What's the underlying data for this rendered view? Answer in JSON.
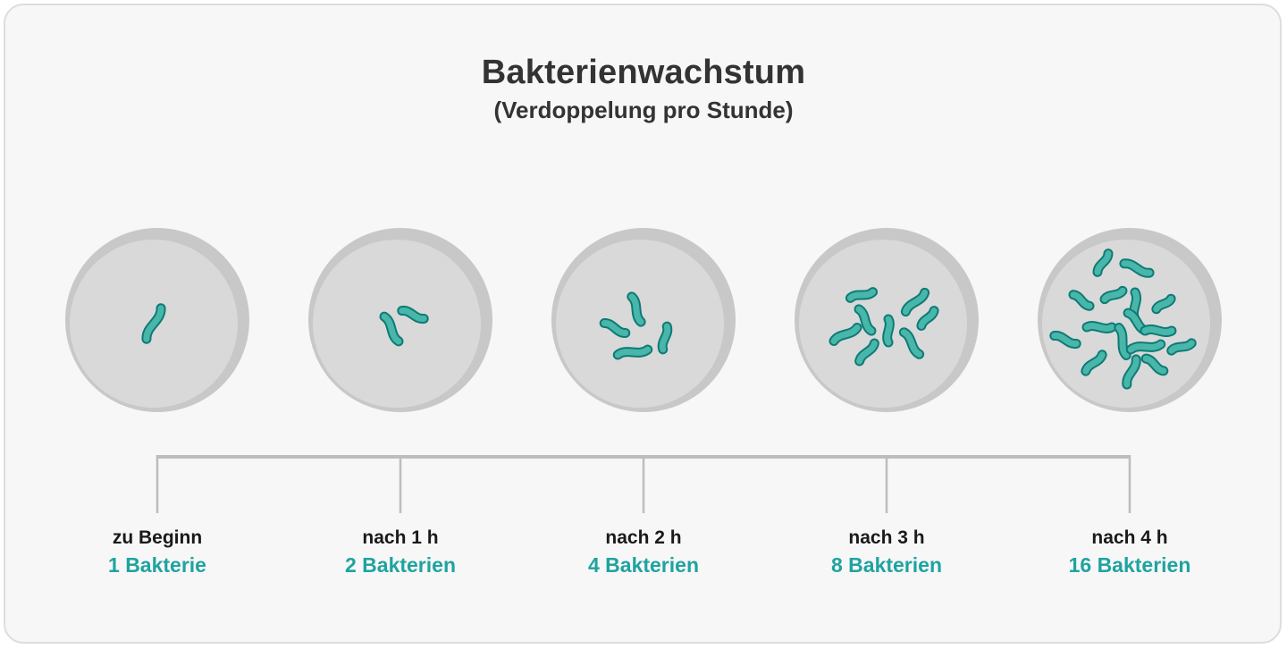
{
  "title": "Bakterienwachstum",
  "subtitle": "(Verdoppelung pro Stunde)",
  "colors": {
    "accent": "#1fa3a0",
    "bacterium_fill": "#48b7aa",
    "bacterium_outline": "#0e7a76",
    "dish_rim": "#c8c8c8",
    "dish_inner": "#d9d9d9",
    "timeline": "#bdbdbd",
    "text": "#1a1a1a"
  },
  "stages": [
    {
      "time_label": "zu Beginn",
      "count_label": "1 Bakterie",
      "bacteria_count": 1
    },
    {
      "time_label": "nach 1 h",
      "count_label": "2 Bakterien",
      "bacteria_count": 2
    },
    {
      "time_label": "nach 2 h",
      "count_label": "4 Bakterien",
      "bacteria_count": 4
    },
    {
      "time_label": "nach 3 h",
      "count_label": "8 Bakterien",
      "bacteria_count": 8
    },
    {
      "time_label": "nach 4 h",
      "count_label": "16 Bakterien",
      "bacteria_count": 16
    }
  ]
}
